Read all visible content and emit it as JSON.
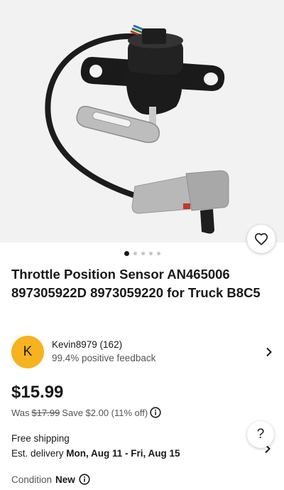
{
  "listing": {
    "title": "Throttle Position Sensor AN465006 897305922D 8973059220 for Truck B8C5",
    "image_count": 5,
    "active_image": 1
  },
  "seller": {
    "avatar_letter": "K",
    "name": "Kevin8979 (162)",
    "feedback": "99.4% positive feedback",
    "avatar_color": "#f6b21f"
  },
  "pricing": {
    "price": "$15.99",
    "was_label": "Was",
    "was_price": "$17.99",
    "save_text": "Save $2.00 (11% off)"
  },
  "shipping": {
    "label": "Free shipping",
    "delivery_label": "Est. delivery",
    "delivery_dates": "Mon, Aug 11 - Fri, Aug 15"
  },
  "condition": {
    "label": "Condition",
    "value": "New"
  },
  "help": {
    "label": "?"
  },
  "icons": {
    "favorite": "heart-icon",
    "seller_chevron": "chevron-right-icon",
    "info": "info-icon",
    "help": "help-icon"
  }
}
